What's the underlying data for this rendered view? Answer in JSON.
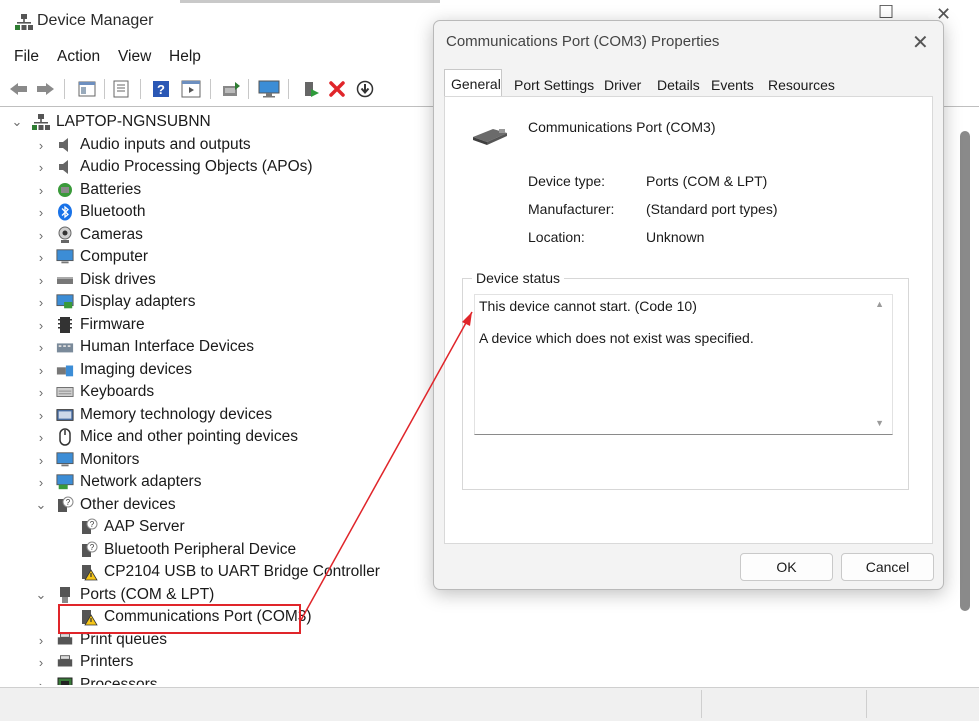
{
  "window": {
    "title": "Device Manager",
    "title_icon": "device-manager-icon"
  },
  "menu": [
    "File",
    "Action",
    "View",
    "Help"
  ],
  "toolbar": {
    "icons": [
      "back-arrow-icon",
      "forward-arrow-icon",
      "show-hide-console-tree-icon",
      "properties-icon",
      "help-icon",
      "run-icon",
      "update-driver-icon",
      "monitor-icon",
      "enable-device-icon",
      "uninstall-device-icon",
      "scan-download-icon"
    ]
  },
  "tree": {
    "root": "LAPTOP-NGNSUBNN",
    "categories": [
      {
        "label": "Audio inputs and outputs",
        "icon": "speaker-icon"
      },
      {
        "label": "Audio Processing Objects (APOs)",
        "icon": "speaker-icon"
      },
      {
        "label": "Batteries",
        "icon": "battery-icon"
      },
      {
        "label": "Bluetooth",
        "icon": "bluetooth-icon"
      },
      {
        "label": "Cameras",
        "icon": "camera-icon"
      },
      {
        "label": "Computer",
        "icon": "computer-icon"
      },
      {
        "label": "Disk drives",
        "icon": "disk-drive-icon"
      },
      {
        "label": "Display adapters",
        "icon": "display-adapter-icon"
      },
      {
        "label": "Firmware",
        "icon": "firmware-icon"
      },
      {
        "label": "Human Interface Devices",
        "icon": "hid-icon"
      },
      {
        "label": "Imaging devices",
        "icon": "imaging-icon"
      },
      {
        "label": "Keyboards",
        "icon": "keyboard-icon"
      },
      {
        "label": "Memory technology devices",
        "icon": "memory-icon"
      },
      {
        "label": "Mice and other pointing devices",
        "icon": "mouse-icon"
      },
      {
        "label": "Monitors",
        "icon": "monitor-icon"
      },
      {
        "label": "Network adapters",
        "icon": "network-icon"
      }
    ],
    "other_devices": {
      "label": "Other devices",
      "children": [
        "AAP Server",
        "Bluetooth Peripheral Device",
        "CP2104 USB to UART Bridge Controller"
      ]
    },
    "ports": {
      "label": "Ports (COM & LPT)",
      "children": [
        "Communications Port (COM3)"
      ]
    },
    "after": [
      "Print queues",
      "Printers",
      "Processors"
    ]
  },
  "dialog": {
    "title": "Communications Port (COM3) Properties",
    "tabs": [
      "General",
      "Port Settings",
      "Driver",
      "Details",
      "Events",
      "Resources"
    ],
    "active_tab": "General",
    "device_name": "Communications Port (COM3)",
    "properties": [
      {
        "label": "Device type:",
        "value": "Ports (COM & LPT)"
      },
      {
        "label": "Manufacturer:",
        "value": "(Standard port types)"
      },
      {
        "label": "Location:",
        "value": "Unknown"
      }
    ],
    "status_group_label": "Device status",
    "status_line1": "This device cannot start. (Code 10)",
    "status_line2": "A device which does not exist was specified.",
    "ok_label": "OK",
    "cancel_label": "Cancel"
  },
  "colors": {
    "annotation_red": "#e0252a",
    "warning_yellow": "#f5c518",
    "bluetooth_blue": "#1a73e8"
  }
}
